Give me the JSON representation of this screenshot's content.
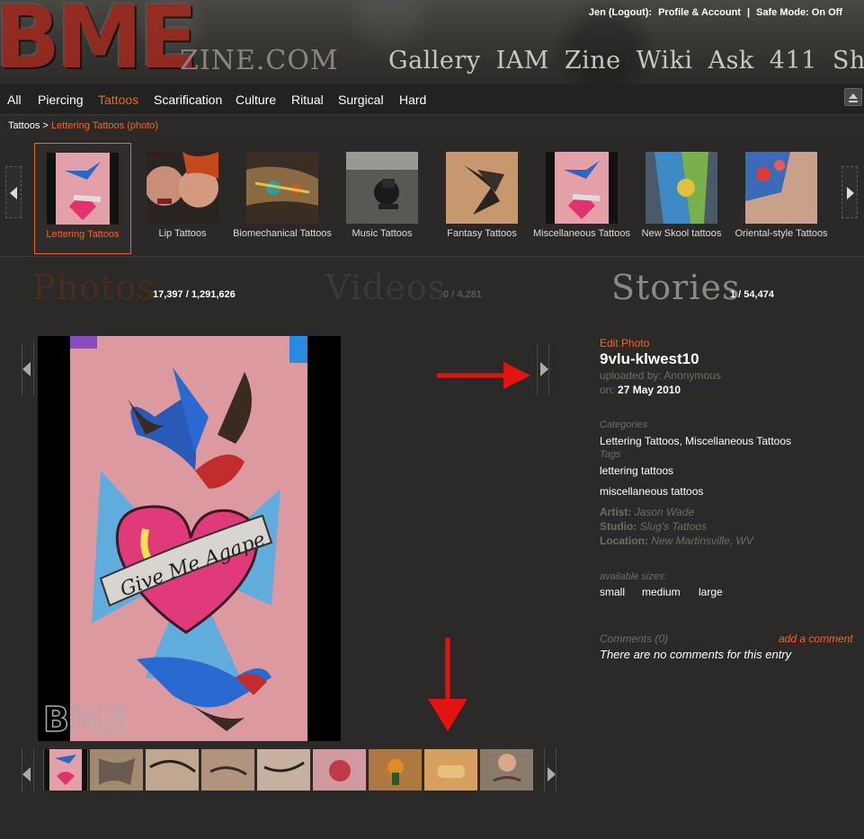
{
  "header": {
    "logo_main": "BME",
    "logo_sub": "ZINE.COM",
    "nav": [
      "Gallery",
      "IAM",
      "Zine",
      "Wiki",
      "Ask",
      "411",
      "Shop"
    ],
    "user": {
      "name": "Jen",
      "logout": "(Logout):",
      "profile": "Profile & Account",
      "separator": "|",
      "safe_mode": "Safe Mode: On Off"
    }
  },
  "categories": [
    "All",
    "Piercing",
    "Tattoos",
    "Scarification",
    "Culture",
    "Ritual",
    "Surgical",
    "Hard"
  ],
  "active_category": "Tattoos",
  "breadcrumb": {
    "root": "Tattoos",
    "separator": ">",
    "current": "Lettering Tattoos (photo)"
  },
  "subcategories": [
    {
      "label": "Lettering Tattoos",
      "active": true,
      "icon": "swallow-heart-thumb"
    },
    {
      "label": "Lip Tattoos",
      "active": false,
      "icon": "lip-thumb"
    },
    {
      "label": "Biomechanical Tattoos",
      "active": false,
      "icon": "biomech-thumb"
    },
    {
      "label": "Music Tattoos",
      "active": false,
      "icon": "music-thumb"
    },
    {
      "label": "Fantasy Tattoos",
      "active": false,
      "icon": "fantasy-thumb"
    },
    {
      "label": "Miscellaneous Tattoos",
      "active": false,
      "icon": "swallow-heart-thumb"
    },
    {
      "label": "New Skool tattoos",
      "active": false,
      "icon": "newskool-thumb"
    },
    {
      "label": "Oriental-style Tattoos",
      "active": false,
      "icon": "oriental-thumb"
    }
  ],
  "stats": {
    "photos": {
      "label": "Photos",
      "count": "17,397 / 1,291,626"
    },
    "videos": {
      "label": "Videos",
      "count": "0 / 4,281"
    },
    "stories": {
      "label": "Stories",
      "count": "1 / 54,474"
    }
  },
  "photo": {
    "watermark": "BME",
    "script_text": "Give Me Agape"
  },
  "details": {
    "edit": "Edit Photo",
    "title": "9vlu-klwest10",
    "uploaded_by_label": "uploaded by:",
    "uploaded_by": "Anonymous",
    "on_label": "on:",
    "date": "27 May 2010",
    "categories_label": "Categories",
    "categories": "Lettering Tattoos, Miscellaneous Tattoos",
    "tags_label": "Tags",
    "tags": [
      "lettering tattoos",
      "miscellaneous tattoos"
    ],
    "artist_label": "Artist:",
    "artist": "Jason Wade",
    "studio_label": "Studio:",
    "studio": "Slug's Tattoos",
    "location_label": "Location:",
    "location": "New Martinsville, WV",
    "sizes_label": "available sizes:",
    "sizes": [
      "small",
      "medium",
      "large"
    ],
    "comments_label": "Comments (0)",
    "add_comment": "add a comment",
    "no_comments": "There are no comments for this entry"
  },
  "colors": {
    "accent": "#f26522",
    "muted": "#6f6d68",
    "annotation": "#e3140f"
  }
}
